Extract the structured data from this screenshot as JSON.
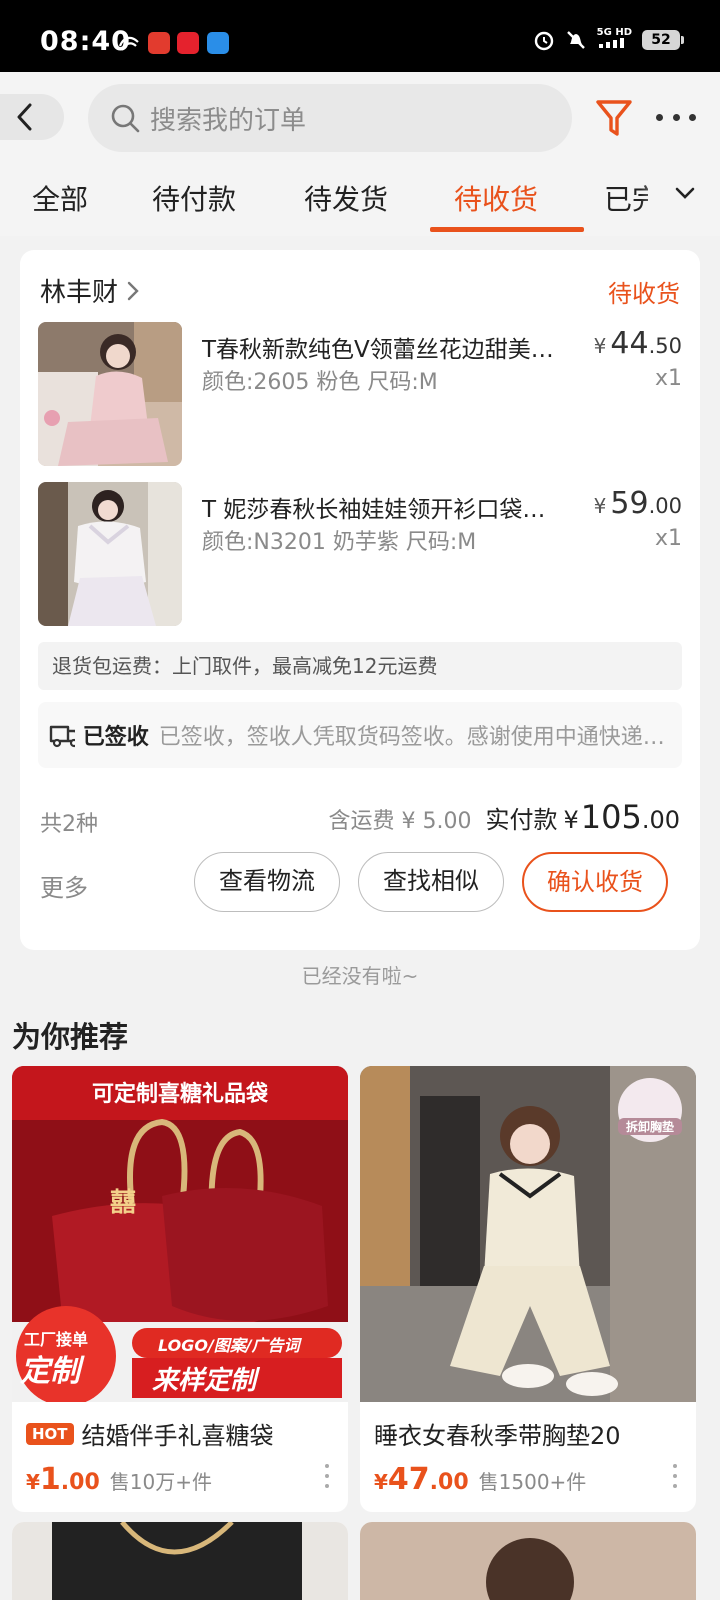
{
  "status_bar": {
    "time": "08:40",
    "network": "5G HD",
    "battery": "52"
  },
  "header": {
    "search_placeholder": "搜索我的订单"
  },
  "tabs": [
    {
      "label": "全部"
    },
    {
      "label": "待付款"
    },
    {
      "label": "待发货"
    },
    {
      "label": "待收货",
      "active": true
    },
    {
      "label": "已完成"
    }
  ],
  "order": {
    "shop_name": "林丰财",
    "status": "待收货",
    "items": [
      {
        "title": "T春秋新款纯色V领蕾丝花边甜美睡衣",
        "spec": "颜色:2605 粉色 尺码:M",
        "price_currency": "¥",
        "price_int": "44",
        "price_dec": ".50",
        "qty": "x1"
      },
      {
        "title": "T 妮莎春秋长袖娃娃领开衫口袋睡衣",
        "spec": "颜色:N3201 奶芋紫 尺码:M",
        "price_currency": "¥",
        "price_int": "59",
        "price_dec": ".00",
        "qty": "x1"
      }
    ],
    "return_note": "退货包运费：上门取件，最高减免12元运费",
    "logistics_status": "已签收",
    "logistics_detail": "已签收，签收人凭取货码签收。感谢使用中通快递，期待再次为您服务！",
    "count_label": "共2种",
    "shipping_fee": "含运费 ¥ 5.00",
    "paid_label": "实付款",
    "paid_currency": "¥",
    "paid_int": "105",
    "paid_dec": ".00",
    "more_label": "更多",
    "buttons": {
      "logistics": "查看物流",
      "similar": "查找相似",
      "confirm": "确认收货"
    }
  },
  "end_text": "已经没有啦~",
  "recommend": {
    "title": "为你推荐",
    "products": [
      {
        "badge": "HOT",
        "title": "结婚伴手礼喜糖袋",
        "price_currency": "¥",
        "price_int": "1",
        "price_dec": ".00",
        "sold": "售10万+件",
        "banner_top": "可定制喜糖礼品袋",
        "tag_factory": "工厂接单",
        "tag_custom": "定制",
        "tag_logo": "LOGO/图案/广告词",
        "tag_sample": "来样定制",
        "emblem": "囍"
      },
      {
        "title": "睡衣女春秋季带胸垫20",
        "price_currency": "¥",
        "price_int": "47",
        "price_dec": ".00",
        "sold": "售1500+件",
        "corner_badge": "拆卸胸垫"
      }
    ]
  },
  "colors": {
    "accent": "#e9521c",
    "muted": "#8a8a8a"
  }
}
